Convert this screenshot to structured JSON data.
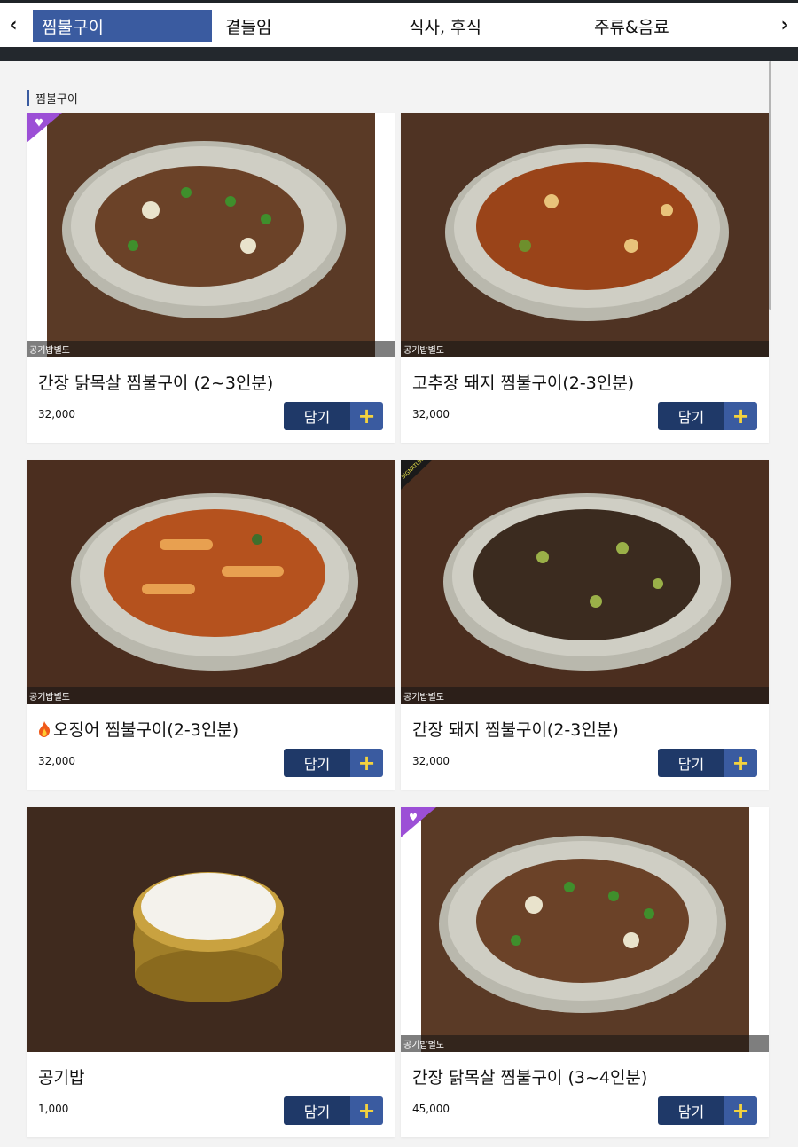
{
  "nav": {
    "tabs": [
      {
        "label": "찜불구이",
        "active": true
      },
      {
        "label": "곁들임"
      },
      {
        "label": "식사, 후식"
      },
      {
        "label": "주류&음료"
      }
    ]
  },
  "section": {
    "title": "찜불구이"
  },
  "colors": {
    "accent": "#3a5ba0",
    "button_dark": "#1f3968",
    "plus": "#f3d23e"
  },
  "products": [
    {
      "name": "간장 닭목살 찜불구이 (2~3인분)",
      "price": "32,000",
      "caption": "공기밥별도",
      "button": "담기",
      "badge": "heart-badge-icon"
    },
    {
      "name": "고추장 돼지 찜불구이(2-3인분)",
      "price": "32,000",
      "caption": "공기밥별도",
      "button": "담기"
    },
    {
      "name": "오징어 찜불구이(2-3인분)",
      "price": "32,000",
      "caption": "공기밥별도",
      "button": "담기",
      "icon": "fire-icon"
    },
    {
      "name": "간장 돼지 찜불구이(2-3인분)",
      "price": "32,000",
      "caption": "공기밥별도",
      "button": "담기",
      "badge": "signature-badge",
      "badge_text": "SIGNATURE"
    },
    {
      "name": "공기밥",
      "price": "1,000",
      "button": "담기"
    },
    {
      "name": "간장 닭목살 찜불구이 (3~4인분)",
      "price": "45,000",
      "caption": "공기밥별도",
      "button": "담기",
      "badge": "heart-badge-icon"
    }
  ]
}
